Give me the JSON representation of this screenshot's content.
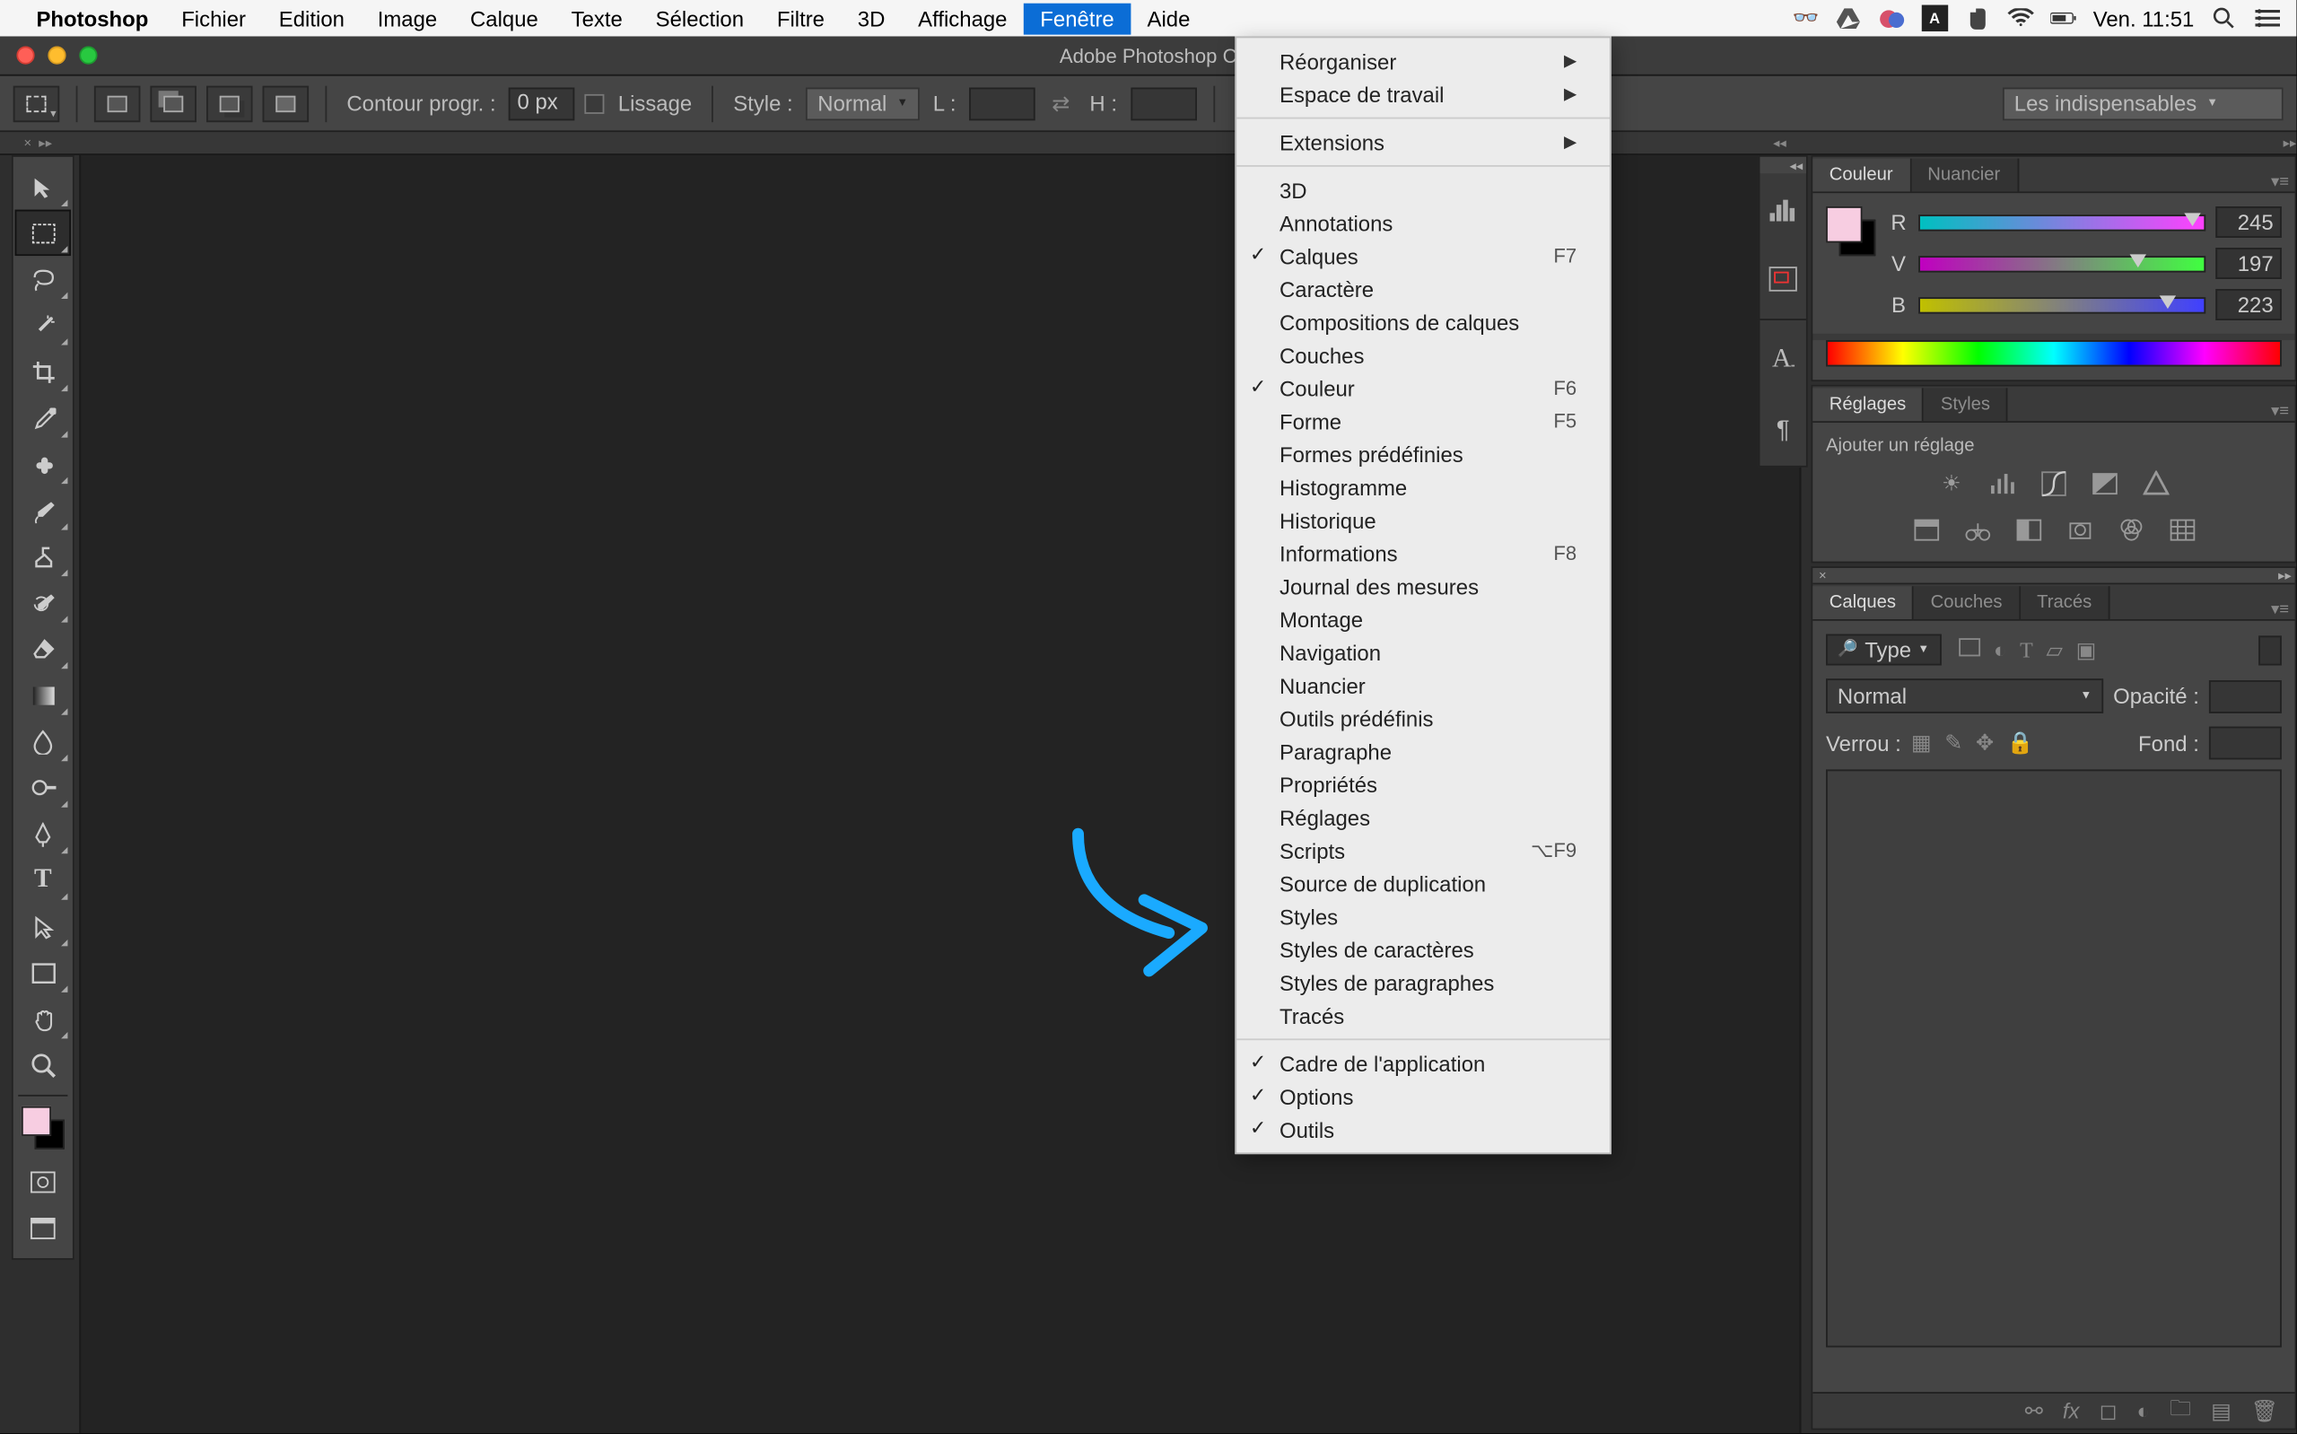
{
  "menubar": {
    "app_name": "Photoshop",
    "items": [
      "Fichier",
      "Edition",
      "Image",
      "Calque",
      "Texte",
      "Sélection",
      "Filtre",
      "3D",
      "Affichage",
      "Fenêtre",
      "Aide"
    ],
    "active_index": 9,
    "clock": "Ven. 11:51"
  },
  "window": {
    "title": "Adobe Photoshop C"
  },
  "optionsbar": {
    "feather_label": "Contour progr. :",
    "feather_value": "0 px",
    "antialias_label": "Lissage",
    "style_label": "Style :",
    "style_value": "Normal",
    "width_label": "L :",
    "height_label": "H :",
    "workspace_selected": "Les indispensables"
  },
  "dropdown": {
    "sections": [
      [
        {
          "label": "Réorganiser",
          "submenu": true
        },
        {
          "label": "Espace de travail",
          "submenu": true
        }
      ],
      [
        {
          "label": "Extensions",
          "submenu": true
        }
      ],
      [
        {
          "label": "3D"
        },
        {
          "label": "Annotations"
        },
        {
          "label": "Calques",
          "checked": true,
          "shortcut": "F7"
        },
        {
          "label": "Caractère"
        },
        {
          "label": "Compositions de calques"
        },
        {
          "label": "Couches"
        },
        {
          "label": "Couleur",
          "checked": true,
          "shortcut": "F6"
        },
        {
          "label": "Forme",
          "shortcut": "F5"
        },
        {
          "label": "Formes prédéfinies"
        },
        {
          "label": "Histogramme"
        },
        {
          "label": "Historique"
        },
        {
          "label": "Informations",
          "shortcut": "F8"
        },
        {
          "label": "Journal des mesures"
        },
        {
          "label": "Montage"
        },
        {
          "label": "Navigation"
        },
        {
          "label": "Nuancier"
        },
        {
          "label": "Outils prédéfinis"
        },
        {
          "label": "Paragraphe"
        },
        {
          "label": "Propriétés"
        },
        {
          "label": "Réglages"
        },
        {
          "label": "Scripts",
          "shortcut": "⌥F9"
        },
        {
          "label": "Source de duplication"
        },
        {
          "label": "Styles"
        },
        {
          "label": "Styles de caractères"
        },
        {
          "label": "Styles de paragraphes"
        },
        {
          "label": "Tracés"
        }
      ],
      [
        {
          "label": "Cadre de l'application",
          "checked": true
        },
        {
          "label": "Options",
          "checked": true
        },
        {
          "label": "Outils",
          "checked": true
        }
      ]
    ]
  },
  "panels": {
    "color": {
      "tabs": [
        "Couleur",
        "Nuancier"
      ],
      "channels": [
        {
          "label": "R",
          "value": "245",
          "gradient": "linear-gradient(90deg,#00c0c0,#ff40ff)",
          "pos": 96
        },
        {
          "label": "V",
          "value": "197",
          "gradient": "linear-gradient(90deg,#c000c0,#40ff40)",
          "pos": 77
        },
        {
          "label": "B",
          "value": "223",
          "gradient": "linear-gradient(90deg,#c0c000,#4040ff)",
          "pos": 87
        }
      ]
    },
    "adjustments": {
      "tabs": [
        "Réglages",
        "Styles"
      ],
      "prompt": "Ajouter un réglage"
    },
    "layers": {
      "tabs": [
        "Calques",
        "Couches",
        "Tracés"
      ],
      "filter_label": "Type",
      "blend_mode": "Normal",
      "opacity_label": "Opacité :",
      "lock_label": "Verrou :",
      "fill_label": "Fond :"
    }
  },
  "right_strip_icons": [
    "histogram-icon",
    "navigator-icon",
    "character-icon",
    "paragraph-icon"
  ]
}
